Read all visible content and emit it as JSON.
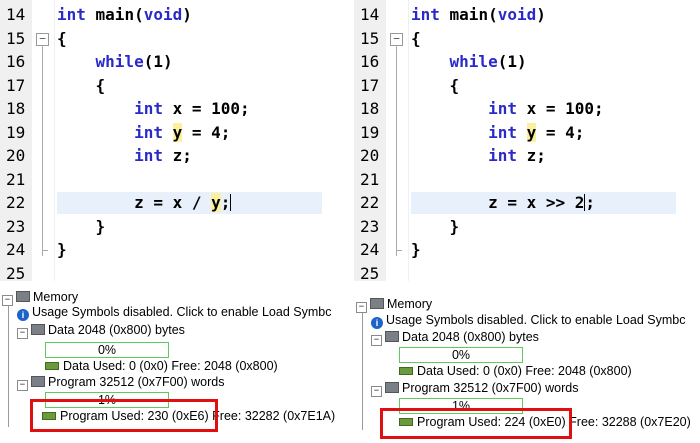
{
  "left": {
    "code": {
      "lines": [
        {
          "num": "14",
          "tokens": [
            {
              "t": "int",
              "c": "kw"
            },
            {
              "t": " main(",
              "c": "b"
            },
            {
              "t": "void",
              "c": "kw"
            },
            {
              "t": ")",
              "c": "b"
            }
          ]
        },
        {
          "num": "15",
          "tokens": [
            {
              "t": "{",
              "c": "b"
            }
          ]
        },
        {
          "num": "16",
          "tokens": [
            {
              "t": "    "
            },
            {
              "t": "while",
              "c": "kw"
            },
            {
              "t": "(1)",
              "c": "b"
            }
          ]
        },
        {
          "num": "17",
          "tokens": [
            {
              "t": "    "
            },
            {
              "t": "{",
              "c": "b"
            }
          ]
        },
        {
          "num": "18",
          "tokens": [
            {
              "t": "        "
            },
            {
              "t": "int",
              "c": "kw"
            },
            {
              "t": " x = 100;",
              "c": "b"
            }
          ]
        },
        {
          "num": "19",
          "tokens": [
            {
              "t": "        "
            },
            {
              "t": "int",
              "c": "kw"
            },
            {
              "t": " ",
              "c": "b"
            },
            {
              "t": "y",
              "c": "b yhl"
            },
            {
              "t": " = 4;",
              "c": "b"
            }
          ]
        },
        {
          "num": "20",
          "tokens": [
            {
              "t": "        "
            },
            {
              "t": "int",
              "c": "kw"
            },
            {
              "t": " z;",
              "c": "b"
            }
          ]
        },
        {
          "num": "21",
          "tokens": []
        },
        {
          "num": "22",
          "tokens": [
            {
              "t": "        "
            },
            {
              "t": "z = x / ",
              "c": "b"
            },
            {
              "t": "y",
              "c": "b yhl"
            },
            {
              "t": ";",
              "c": "b"
            },
            {
              "t": "",
              "c": "caret"
            }
          ]
        },
        {
          "num": "23",
          "tokens": [
            {
              "t": "    "
            },
            {
              "t": "}",
              "c": "b"
            }
          ]
        },
        {
          "num": "24",
          "tokens": [
            {
              "t": "}",
              "c": "b"
            }
          ]
        },
        {
          "num": "25",
          "tokens": []
        }
      ]
    },
    "memory": {
      "root": "Memory",
      "info": "Usage Symbols disabled. Click to enable Load Symbc",
      "data_label": "Data 2048 (0x800) bytes",
      "data_pct": "0%",
      "data_used": "Data Used: 0 (0x0) Free: 2048 (0x800)",
      "prog_label": "Program 32512 (0x7F00) words",
      "prog_pct": "1%",
      "prog_used": "Program Used: 230 (0xE6)",
      "prog_free": "Free: 32282 (0x7E1A)"
    }
  },
  "right": {
    "code": {
      "lines": [
        {
          "num": "14",
          "tokens": [
            {
              "t": "int",
              "c": "kw"
            },
            {
              "t": " main(",
              "c": "b"
            },
            {
              "t": "void",
              "c": "kw"
            },
            {
              "t": ")",
              "c": "b"
            }
          ]
        },
        {
          "num": "15",
          "tokens": [
            {
              "t": "{",
              "c": "b"
            }
          ]
        },
        {
          "num": "16",
          "tokens": [
            {
              "t": "    "
            },
            {
              "t": "while",
              "c": "kw"
            },
            {
              "t": "(1)",
              "c": "b"
            }
          ]
        },
        {
          "num": "17",
          "tokens": [
            {
              "t": "    "
            },
            {
              "t": "{",
              "c": "b"
            }
          ]
        },
        {
          "num": "18",
          "tokens": [
            {
              "t": "        "
            },
            {
              "t": "int",
              "c": "kw"
            },
            {
              "t": " x = 100;",
              "c": "b"
            }
          ]
        },
        {
          "num": "19",
          "tokens": [
            {
              "t": "        "
            },
            {
              "t": "int",
              "c": "kw"
            },
            {
              "t": " ",
              "c": "b"
            },
            {
              "t": "y",
              "c": "b yhl"
            },
            {
              "t": " = 4;",
              "c": "b"
            }
          ]
        },
        {
          "num": "20",
          "tokens": [
            {
              "t": "        "
            },
            {
              "t": "int",
              "c": "kw"
            },
            {
              "t": " z;",
              "c": "b"
            }
          ]
        },
        {
          "num": "21",
          "tokens": []
        },
        {
          "num": "22",
          "tokens": [
            {
              "t": "        "
            },
            {
              "t": "z = x >> 2",
              "c": "b"
            },
            {
              "t": "",
              "c": "caret"
            },
            {
              "t": ";",
              "c": "b"
            }
          ]
        },
        {
          "num": "23",
          "tokens": [
            {
              "t": "    "
            },
            {
              "t": "}",
              "c": "b"
            }
          ]
        },
        {
          "num": "24",
          "tokens": [
            {
              "t": "}",
              "c": "b"
            }
          ]
        },
        {
          "num": "25",
          "tokens": []
        }
      ]
    },
    "memory": {
      "root": "Memory",
      "info": "Usage Symbols disabled. Click to enable Load Symbc",
      "data_label": "Data 2048 (0x800) bytes",
      "data_pct": "0%",
      "data_used": "Data Used: 0 (0x0) Free: 2048 (0x800)",
      "prog_label": "Program 32512 (0x7F00) words",
      "prog_pct": "1%",
      "prog_used": "Program Used: 224 (0xE0)",
      "prog_free": "Free: 32288 (0x7E20)"
    }
  },
  "icons": {
    "fold_open": "−",
    "tree_open": "−",
    "info": "i"
  }
}
